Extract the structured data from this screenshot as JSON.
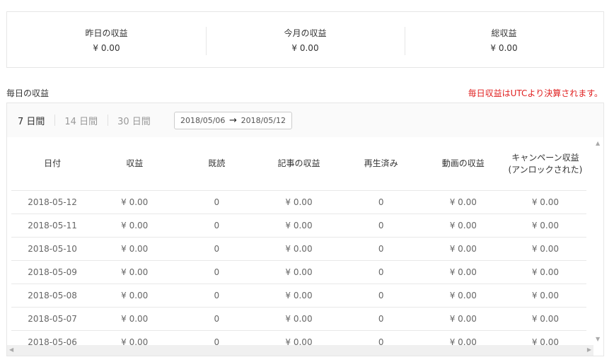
{
  "summary": [
    {
      "label": "昨日の収益",
      "value": "¥ 0.00"
    },
    {
      "label": "今月の収益",
      "value": "¥ 0.00"
    },
    {
      "label": "総収益",
      "value": "¥ 0.00"
    }
  ],
  "section": {
    "title": "毎日の収益",
    "note": "毎日収益はUTCより決算されます。"
  },
  "range_tabs": [
    {
      "label": "7 日間",
      "active": true
    },
    {
      "label": "14 日間",
      "active": false
    },
    {
      "label": "30 日間",
      "active": false
    }
  ],
  "date_range": {
    "start": "2018/05/06",
    "arrow": "→",
    "end": "2018/05/12"
  },
  "table": {
    "headers": [
      "日付",
      "収益",
      "既読",
      "記事の収益",
      "再生済み",
      "動画の収益",
      "キャンペーン収益(アンロックされた)"
    ],
    "rows": [
      [
        "2018-05-12",
        "¥ 0.00",
        "0",
        "¥ 0.00",
        "0",
        "¥ 0.00",
        "¥ 0.00"
      ],
      [
        "2018-05-11",
        "¥ 0.00",
        "0",
        "¥ 0.00",
        "0",
        "¥ 0.00",
        "¥ 0.00"
      ],
      [
        "2018-05-10",
        "¥ 0.00",
        "0",
        "¥ 0.00",
        "0",
        "¥ 0.00",
        "¥ 0.00"
      ],
      [
        "2018-05-09",
        "¥ 0.00",
        "0",
        "¥ 0.00",
        "0",
        "¥ 0.00",
        "¥ 0.00"
      ],
      [
        "2018-05-08",
        "¥ 0.00",
        "0",
        "¥ 0.00",
        "0",
        "¥ 0.00",
        "¥ 0.00"
      ],
      [
        "2018-05-07",
        "¥ 0.00",
        "0",
        "¥ 0.00",
        "0",
        "¥ 0.00",
        "¥ 0.00"
      ],
      [
        "2018-05-06",
        "¥ 0.00",
        "0",
        "¥ 0.00",
        "0",
        "¥ 0.00",
        "¥ 0.00"
      ]
    ]
  },
  "colors": {
    "note": "#e02020",
    "border": "#e6e6e6"
  }
}
